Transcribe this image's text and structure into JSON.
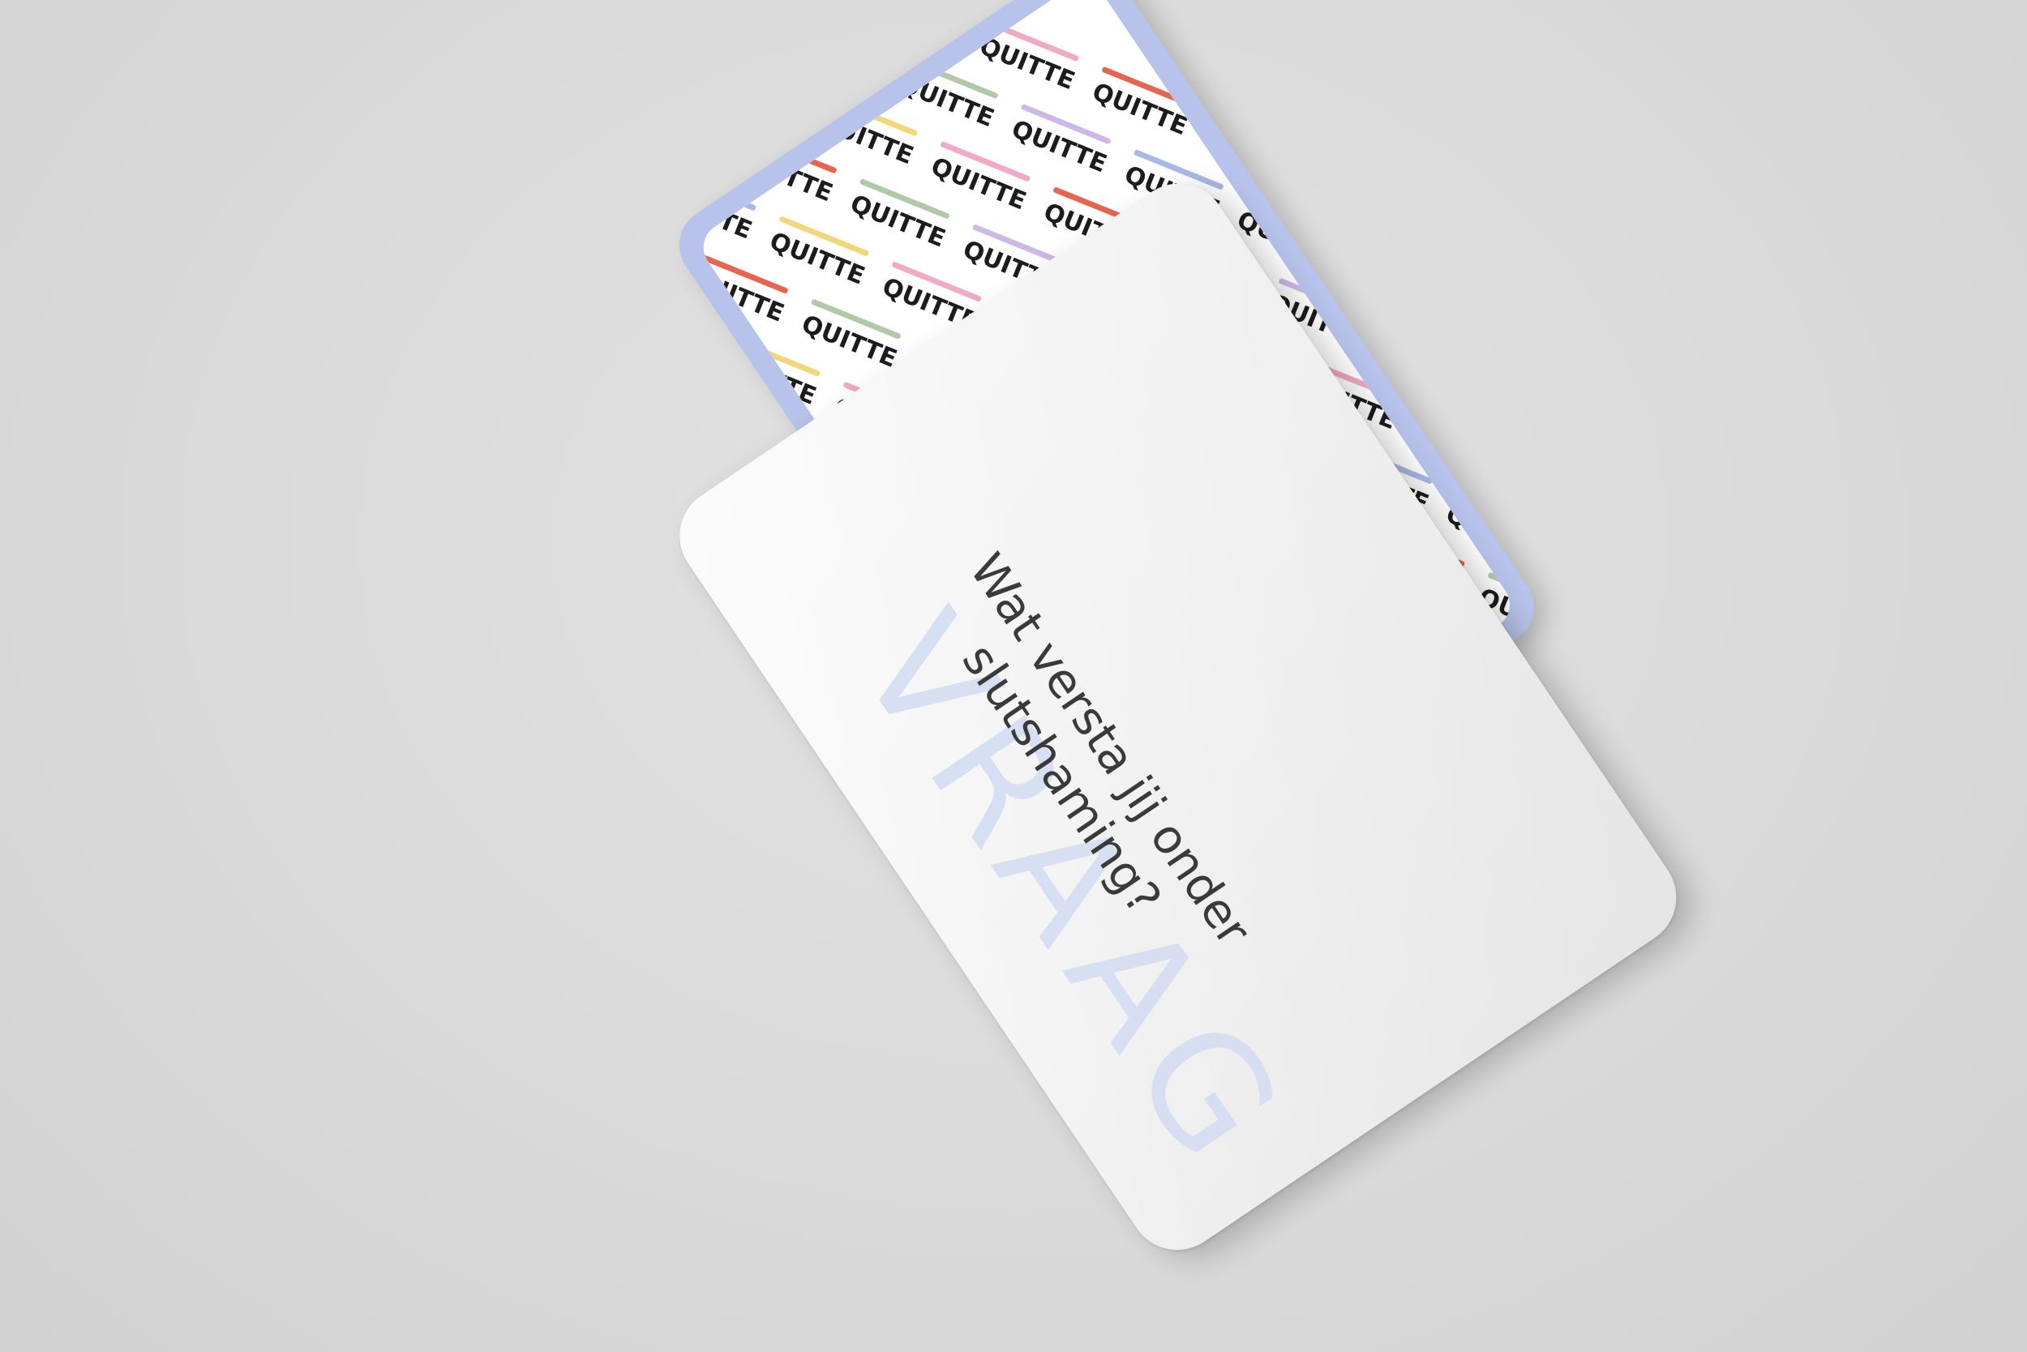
{
  "back_card": {
    "brand_word": "QUITTE",
    "accent_color": "#b7c3ea",
    "stripe_colors": [
      "#a9b9e6",
      "#f2d67a",
      "#f0a9c6",
      "#e7644f",
      "#b2c9a8",
      "#cdb8e6"
    ]
  },
  "front_card": {
    "heading": "VRAAG",
    "question_line_1": "Wat versta jij onder",
    "question_line_2": "slutshaming?"
  }
}
